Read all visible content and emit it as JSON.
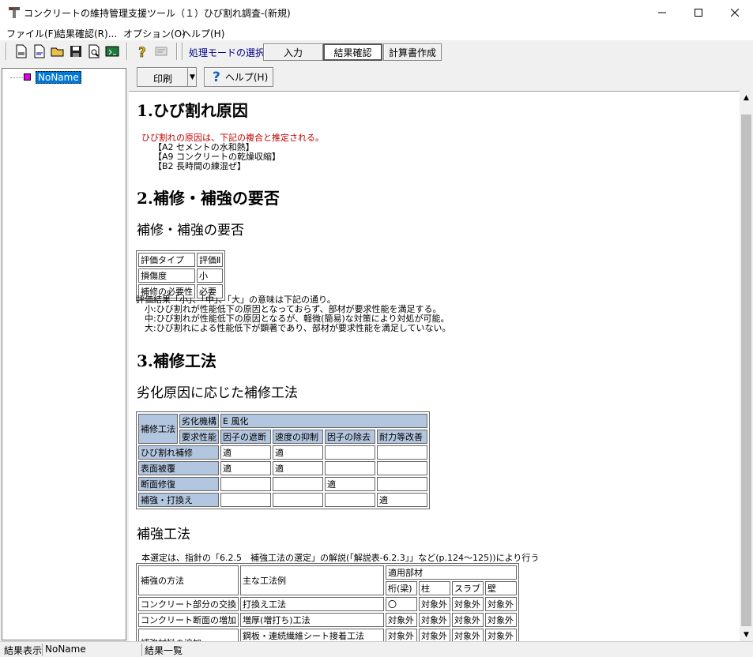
{
  "window": {
    "title": "コンクリートの維持管理支援ツール（１）ひび割れ調査-(新規)"
  },
  "menu": [
    "ファイル(F)",
    "結果確認(R)...",
    "オプション(O)",
    "ヘルプ(H)"
  ],
  "mode": {
    "label": "処理モードの選択",
    "buttons": [
      "入力",
      "結果確認",
      "計算書作成"
    ],
    "active": "結果確認"
  },
  "tree": {
    "root": "NoName"
  },
  "panel": {
    "print": "印刷",
    "help": "ヘルプ(H)"
  },
  "report": {
    "s1": {
      "title": "1.ひび割れ原因",
      "intro": "ひび割れの原因は、下記の複合と推定される。",
      "causes": [
        "【A2 セメントの水和熱】",
        "【A9 コンクリートの乾燥収縮】",
        "【B2 長時間の練混ぜ】"
      ]
    },
    "s2": {
      "title": "2.補修・補強の要否",
      "subtitle": "補修・補強の要否",
      "table": [
        [
          "評価タイプ",
          "評価Ⅱ"
        ],
        [
          "損傷度",
          "小"
        ],
        [
          "補修の必要性",
          "必要"
        ]
      ],
      "notes": [
        "評価結果「小」、「中」、「大」の意味は下記の通り。",
        "　小:ひび割れが性能低下の原因となっておらず、部材が要求性能を満足する。",
        "　中:ひび割れが性能低下の原因となるが、軽微(簡易)な対策により対処が可能。",
        "　大:ひび割れによる性能低下が顕著であり、部材が要求性能を満足していない。"
      ]
    },
    "s3": {
      "title": "3.補修工法",
      "subtitle": "劣化原因に応じた補修工法",
      "table": {
        "corner": "補修工法",
        "h_mech": "劣化機構",
        "mech": "E 風化",
        "h_req": "要求性能",
        "cols": [
          "因子の遮断",
          "速度の抑制",
          "因子の除去",
          "耐力等改善"
        ],
        "rows": [
          {
            "name": "ひび割れ補修",
            "cells": [
              "適",
              "適",
              "",
              ""
            ]
          },
          {
            "name": "表面被覆",
            "cells": [
              "適",
              "適",
              "",
              ""
            ]
          },
          {
            "name": "断面修復",
            "cells": [
              "",
              "",
              "適",
              ""
            ]
          },
          {
            "name": "補強・打換え",
            "cells": [
              "",
              "",
              "",
              "適"
            ]
          }
        ]
      }
    },
    "s4": {
      "title": "補強工法",
      "note": "本選定は、指針の「6.2.5　補強工法の選定」の解説(「解説表-6.2.3」」など(p.124～125))により行う",
      "table": {
        "h_method": "補強の方法",
        "h_example": "主な工法例",
        "h_parts": "適用部材",
        "parts": [
          "桁(梁)",
          "柱",
          "スラブ",
          "壁"
        ],
        "rows": [
          {
            "method": "コンクリート部分の交換",
            "example": "打換え工法",
            "cells": [
              "〇",
              "対象外",
              "対象外",
              "対象外"
            ]
          },
          {
            "method": "コンクリート断面の増加",
            "example": "増厚(増打ち)工法",
            "cells": [
              "対象外",
              "対象外",
              "対象外",
              "対象外"
            ]
          },
          {
            "method": "補強材料の追加",
            "example": "鋼板・連続繊維シート接着工法",
            "cells": [
              "対象外",
              "対象外",
              "対象外",
              "対象外"
            ]
          }
        ]
      }
    }
  },
  "status": [
    "結果表示",
    "NoName",
    "結果一覧"
  ]
}
